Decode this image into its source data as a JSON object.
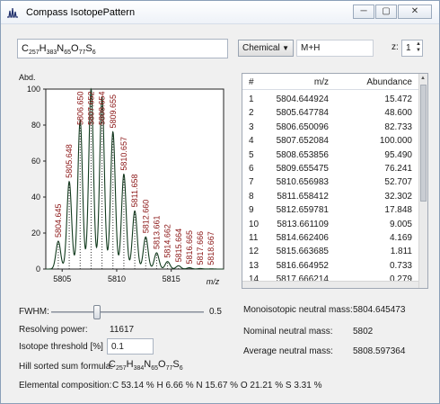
{
  "window": {
    "title": "Compass IsotopePattern",
    "minimize_glyph": "─",
    "maximize_glyph": "▢",
    "close_glyph": "✕"
  },
  "formula": {
    "parts": [
      [
        "C",
        "257"
      ],
      [
        "H",
        "383"
      ],
      [
        "N",
        "65"
      ],
      [
        "O",
        "77"
      ],
      [
        "S",
        "6"
      ]
    ]
  },
  "mode_select": {
    "value": "Chemical"
  },
  "adduct": {
    "value": "M+H"
  },
  "charge": {
    "label": "z:",
    "value": "1"
  },
  "chart_data": {
    "type": "line",
    "title": "",
    "ylabel": "Abd.",
    "xlabel": "m/z",
    "xlim": [
      5803.5,
      5819.8
    ],
    "ylim": [
      0,
      100
    ],
    "xticks": [
      5805,
      5810,
      5815
    ],
    "yticks": [
      0,
      20,
      40,
      60,
      80,
      100
    ],
    "peaks": [
      {
        "x": 5804.645,
        "y": 15.472,
        "label": "5804.645"
      },
      {
        "x": 5805.648,
        "y": 48.6,
        "label": "5805.648"
      },
      {
        "x": 5806.65,
        "y": 82.733,
        "label": "5806.650"
      },
      {
        "x": 5807.652,
        "y": 100.0,
        "label": "5807.652"
      },
      {
        "x": 5808.654,
        "y": 95.49,
        "label": "5808.654"
      },
      {
        "x": 5809.655,
        "y": 76.241,
        "label": "5809.655"
      },
      {
        "x": 5810.657,
        "y": 52.707,
        "label": "5810.657"
      },
      {
        "x": 5811.658,
        "y": 32.302,
        "label": "5811.658"
      },
      {
        "x": 5812.66,
        "y": 17.848,
        "label": "5812.660"
      },
      {
        "x": 5813.661,
        "y": 9.005,
        "label": "5813.661"
      },
      {
        "x": 5814.662,
        "y": 4.169,
        "label": "5814.662"
      },
      {
        "x": 5815.664,
        "y": 1.811,
        "label": "5815.664"
      },
      {
        "x": 5816.665,
        "y": 0.733,
        "label": "5816.665"
      },
      {
        "x": 5817.666,
        "y": 0.279,
        "label": "5817.666"
      },
      {
        "x": 5818.667,
        "y": 0.1,
        "label": "5818.667"
      }
    ]
  },
  "fwhm": {
    "label": "FWHM:",
    "value": "0.5",
    "slider_fraction": 0.3
  },
  "resolving": {
    "label": "Resolving power:",
    "value": "11617"
  },
  "iso_threshold": {
    "label": "Isotope threshold [%]",
    "value": "0.1"
  },
  "hill": {
    "label": "Hill sorted sum formula:",
    "parts": [
      [
        "C",
        "257"
      ],
      [
        "H",
        "384"
      ],
      [
        "N",
        "65"
      ],
      [
        "O",
        "77"
      ],
      [
        "S",
        "6"
      ]
    ]
  },
  "elemental": {
    "label": "Elemental composition:",
    "value": "C 53.14 % H 6.66 % N 15.67 % O 21.21 % S 3.31 %"
  },
  "table": {
    "headers": [
      "#",
      "m/z",
      "Abundance"
    ],
    "rows": [
      [
        "1",
        "5804.644924",
        "15.472"
      ],
      [
        "2",
        "5805.647784",
        "48.600"
      ],
      [
        "3",
        "5806.650096",
        "82.733"
      ],
      [
        "4",
        "5807.652084",
        "100.000"
      ],
      [
        "5",
        "5808.653856",
        "95.490"
      ],
      [
        "6",
        "5809.655475",
        "76.241"
      ],
      [
        "7",
        "5810.656983",
        "52.707"
      ],
      [
        "8",
        "5811.658412",
        "32.302"
      ],
      [
        "9",
        "5812.659781",
        "17.848"
      ],
      [
        "10",
        "5813.661109",
        "9.005"
      ],
      [
        "11",
        "5814.662406",
        "4.169"
      ],
      [
        "12",
        "5815.663685",
        "1.811"
      ],
      [
        "13",
        "5816.664952",
        "0.733"
      ],
      [
        "14",
        "5817.666214",
        "0.279"
      ]
    ]
  },
  "info": [
    {
      "label": "Monoisotopic neutral mass:",
      "value": "5804.645473"
    },
    {
      "label": "Nominal neutral mass:",
      "value": "5802"
    },
    {
      "label": "Average neutral mass:",
      "value": "5808.597364"
    }
  ]
}
